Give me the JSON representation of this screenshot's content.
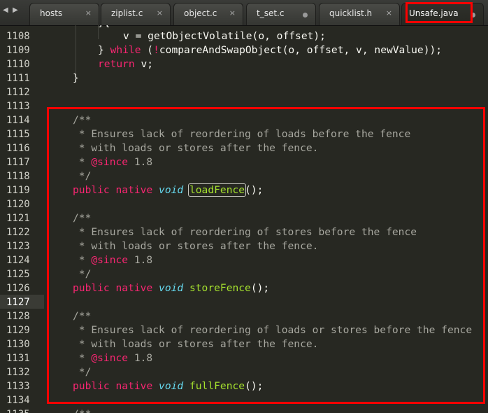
{
  "tabs": [
    {
      "label": "hosts",
      "state": "close"
    },
    {
      "label": "ziplist.c",
      "state": "close"
    },
    {
      "label": "object.c",
      "state": "close"
    },
    {
      "label": "t_set.c",
      "state": "dirty"
    },
    {
      "label": "quicklist.h",
      "state": "close"
    },
    {
      "label": "Unsafe.java",
      "state": "dirty",
      "active": true
    }
  ],
  "icons": {
    "tab_close": "×",
    "nav_left": "◀",
    "nav_right": "▶"
  },
  "colors": {
    "highlight_box": "#ff0000",
    "background": "#272822"
  },
  "editor": {
    "current_line": "1127",
    "lines": [
      {
        "no": "1108"
      },
      {
        "no": "1109"
      },
      {
        "no": "1110"
      },
      {
        "no": "1111"
      },
      {
        "no": "1112"
      },
      {
        "no": "1113"
      },
      {
        "no": "1114"
      },
      {
        "no": "1115"
      },
      {
        "no": "1116"
      },
      {
        "no": "1117"
      },
      {
        "no": "1118"
      },
      {
        "no": "1119"
      },
      {
        "no": "1120"
      },
      {
        "no": "1121"
      },
      {
        "no": "1122"
      },
      {
        "no": "1123"
      },
      {
        "no": "1124"
      },
      {
        "no": "1125"
      },
      {
        "no": "1126"
      },
      {
        "no": "1127"
      },
      {
        "no": "1128"
      },
      {
        "no": "1129"
      },
      {
        "no": "1130"
      },
      {
        "no": "1131"
      },
      {
        "no": "1132"
      },
      {
        "no": "1133"
      },
      {
        "no": "1134"
      },
      {
        "no": "1135"
      }
    ],
    "tokens": {
      "l1108_var": "v",
      "l1108_eq": " = ",
      "l1108_call": "getObjectVolatile",
      "l1108_args": "(o, offset);",
      "l1109_brace": "} ",
      "l1109_while": "while",
      "l1109_open": " (",
      "l1109_not": "!",
      "l1109_call": "compareAndSwapObject",
      "l1109_args": "(o, offset, v, newValue));",
      "l1110_return": "return",
      "l1110_rest": " v;",
      "l1111_brace": "}",
      "doc_open": "/**",
      "doc_close": " */",
      "doc_star": " * ",
      "since_tag": "@since",
      "since_ver": " 1.8",
      "load_desc1": "Ensures lack of reordering of loads before the fence",
      "load_desc2": "with loads or stores after the fence.",
      "store_desc1": "Ensures lack of reordering of stores before the fence",
      "store_desc2": "with loads or stores after the fence.",
      "full_desc1": "Ensures lack of reordering of loads or stores before the fence",
      "full_desc2": "with loads or stores after the fence.",
      "kw_public": "public",
      "kw_native": "native",
      "kw_void": "void",
      "fn_load": "loadFence",
      "fn_store": "storeFence",
      "fn_full": "fullFence",
      "call_end": "();",
      "top_partial": "}{",
      "bottom_partial": "/**"
    }
  }
}
